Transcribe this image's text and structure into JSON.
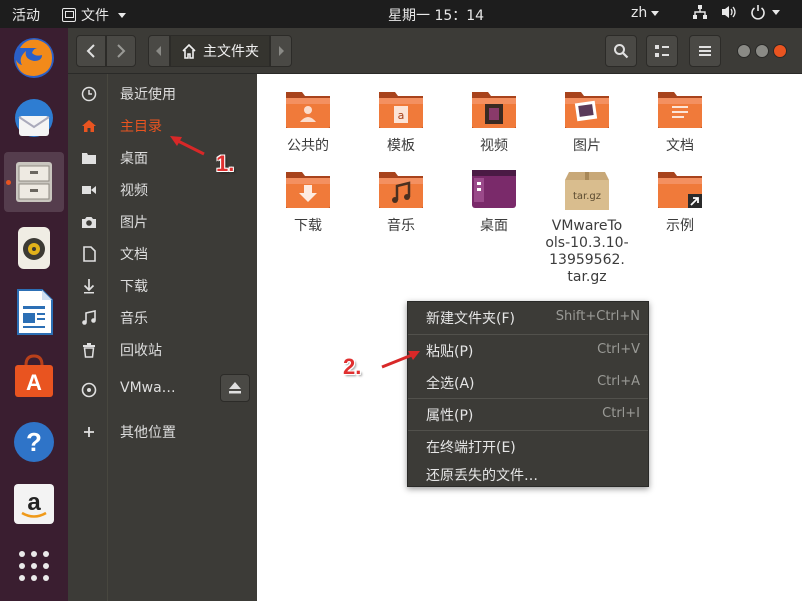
{
  "topbar": {
    "activities": "活动",
    "app_menu": "文件",
    "clock": "星期一 15：14",
    "lang": "zh"
  },
  "dock": {
    "items": [
      "firefox-icon",
      "thunderbird-icon",
      "files-icon",
      "rhythmbox-icon",
      "writer-icon",
      "software-center-icon",
      "help-icon",
      "amazon-icon",
      "app-grid-icon"
    ],
    "active": "files-icon"
  },
  "headerbar": {
    "location": "主文件夹"
  },
  "sidebar": {
    "items": [
      {
        "label": "最近使用",
        "icon": "clock-icon"
      },
      {
        "label": "主目录",
        "icon": "home-icon"
      },
      {
        "label": "桌面",
        "icon": "folder-icon"
      },
      {
        "label": "视频",
        "icon": "video-icon"
      },
      {
        "label": "图片",
        "icon": "camera-icon"
      },
      {
        "label": "文档",
        "icon": "document-icon"
      },
      {
        "label": "下载",
        "icon": "download-icon"
      },
      {
        "label": "音乐",
        "icon": "music-icon"
      },
      {
        "label": "回收站",
        "icon": "trash-icon"
      },
      {
        "label": "VMwa…",
        "icon": "disc-icon"
      },
      {
        "label": "其他位置",
        "icon": "plus-icon"
      }
    ],
    "selected": "主目录"
  },
  "files": [
    {
      "name": "公共的",
      "icon": "folder-public-icon"
    },
    {
      "name": "模板",
      "icon": "folder-templates-icon"
    },
    {
      "name": "视频",
      "icon": "folder-videos-icon"
    },
    {
      "name": "图片",
      "icon": "folder-pictures-icon"
    },
    {
      "name": "文档",
      "icon": "folder-documents-icon"
    },
    {
      "name": "下载",
      "icon": "folder-download-icon"
    },
    {
      "name": "音乐",
      "icon": "folder-music-icon"
    },
    {
      "name": "桌面",
      "icon": "folder-desktop-icon"
    },
    {
      "name": "VMwareTo­ols-10.3.10-13959562.tar.gz",
      "display_lines": [
        "VMwareTo",
        "ols-10.3.10-",
        "13959562.",
        "tar.gz"
      ],
      "icon": "archive-icon",
      "archive_label": "tar.gz"
    },
    {
      "name": "示例",
      "icon": "folder-examples-icon"
    }
  ],
  "context_menu": {
    "items": [
      {
        "label": "新建文件夹(F)",
        "shortcut": "Shift+Ctrl+N"
      },
      {
        "label": "粘贴(P)",
        "shortcut": "Ctrl+V"
      },
      {
        "label": "全选(A)",
        "shortcut": "Ctrl+A"
      },
      {
        "label": "属性(P)",
        "shortcut": "Ctrl+I"
      },
      {
        "label": "在终端打开(E)",
        "shortcut": ""
      },
      {
        "label": "还原丢失的文件…",
        "shortcut": ""
      }
    ]
  },
  "annotations": {
    "step1": "1.",
    "step2": "2.",
    "color": "#e03030"
  },
  "colors": {
    "accent": "#e95420",
    "panel": "#3c3b37",
    "dock": "#3a1e30"
  }
}
